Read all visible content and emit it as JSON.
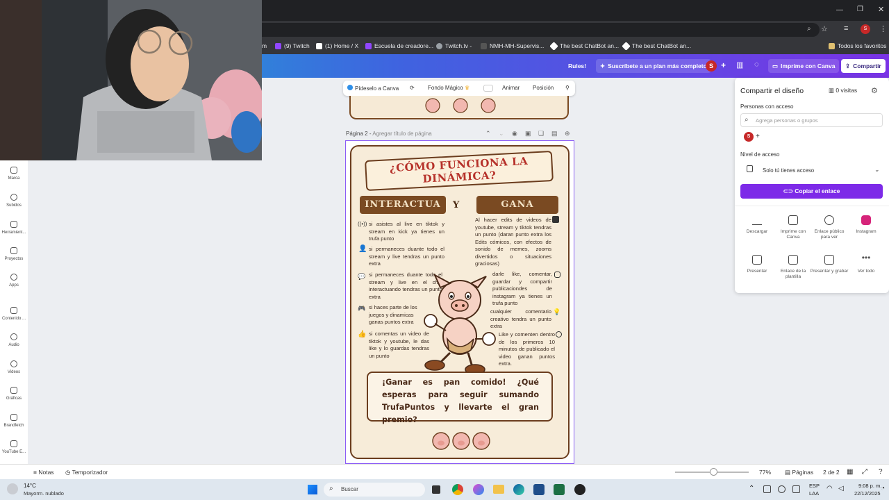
{
  "browser": {
    "bookmarks": [
      "m",
      "(9) Twitch",
      "(1) Home / X",
      "Escuela de creadore...",
      "Twitch.tv -",
      "NMH-MH-Supervis...",
      "The best ChatBot an...",
      "The best ChatBot an...",
      "Todos los favoritos"
    ]
  },
  "header": {
    "rules": "Rules!",
    "subscribe": "Suscríbete a un plan más completo",
    "avatar": "S",
    "print": "Imprime con Canva",
    "share": "Compartir"
  },
  "toolbar": {
    "ask": "Pídeselo a Canva",
    "magic_bg": "Fondo Mágico",
    "animate": "Animar",
    "position": "Posición"
  },
  "page": {
    "label": "Página 2",
    "title_placeholder": "Agregar título de página"
  },
  "sidebar": {
    "items": [
      "Marca",
      "Subidos",
      "Herramient...",
      "Proyectos",
      "Apps",
      "Contenido ...",
      "Audio",
      "Videos",
      "Gráficas",
      "Brandfetch",
      "YouTube E..."
    ]
  },
  "poster": {
    "title": "¿CÓMO FUNCIONA LA DINÁMICA?",
    "left_heading": "INTERACTUA",
    "connector": "Y",
    "right_heading": "GANA",
    "left_items": [
      "si asistes al live en tiktok y stream en kick ya tienes un trufa punto",
      "si permaneces duante todo el stream y live tendras un punto extra",
      "si permaneces duante todo el stream y live en el chat interactuando tendras un punto extra",
      "si haces parte de los juegos y dinamicas ganas puntos extra",
      "si comentas un video de tiktok y youtube, le das like y lo guardas tendras un punto"
    ],
    "right_items": [
      "Al hacer edits de videos de youtube, stream y tiktok tendras un punto (daran punto extra los Edits cómicos, con efectos de sonido de memes, zooms divertidos o situaciones graciosas)",
      "darle like, comentar, guardar y compartir publicaciondes de instagram ya tienes un trufa punto",
      "cualquier comentario creativo tendra un punto extra",
      "Like y comenten dentro de los primeros 10 minutos de publicado el video ganan puntos extra."
    ],
    "cta": "¡Ganar es pan comido! ¿Qué esperas para seguir sumando TrufaPuntos y llevarte el gran premio?"
  },
  "share_panel": {
    "title": "Compartir el diseño",
    "visits": "0 visitas",
    "people_label": "Personas con acceso",
    "search_placeholder": "Agrega personas o grupos",
    "avatar": "S",
    "access_label": "Nivel de acceso",
    "access_value": "Solo tú tienes acceso",
    "copy_link": "Copiar el enlace",
    "actions": [
      "Descargar",
      "Imprime con Canva",
      "Enlace público para ver",
      "Instagram",
      "Presentar",
      "Enlace de la plantilla",
      "Presentar y grabar",
      "Ver todo"
    ],
    "instagram_color": "#d6247a"
  },
  "bottom": {
    "notes": "Notas",
    "timer": "Temporizador",
    "zoom": "77%",
    "pages": "Páginas",
    "page_count": "2 de 2"
  },
  "taskbar": {
    "temp": "14°C",
    "weather": "Mayorm. nublado",
    "search": "Buscar",
    "lang1": "ESP",
    "lang2": "LAA",
    "time": "9:08 p. m.",
    "date": "22/12/2025"
  }
}
